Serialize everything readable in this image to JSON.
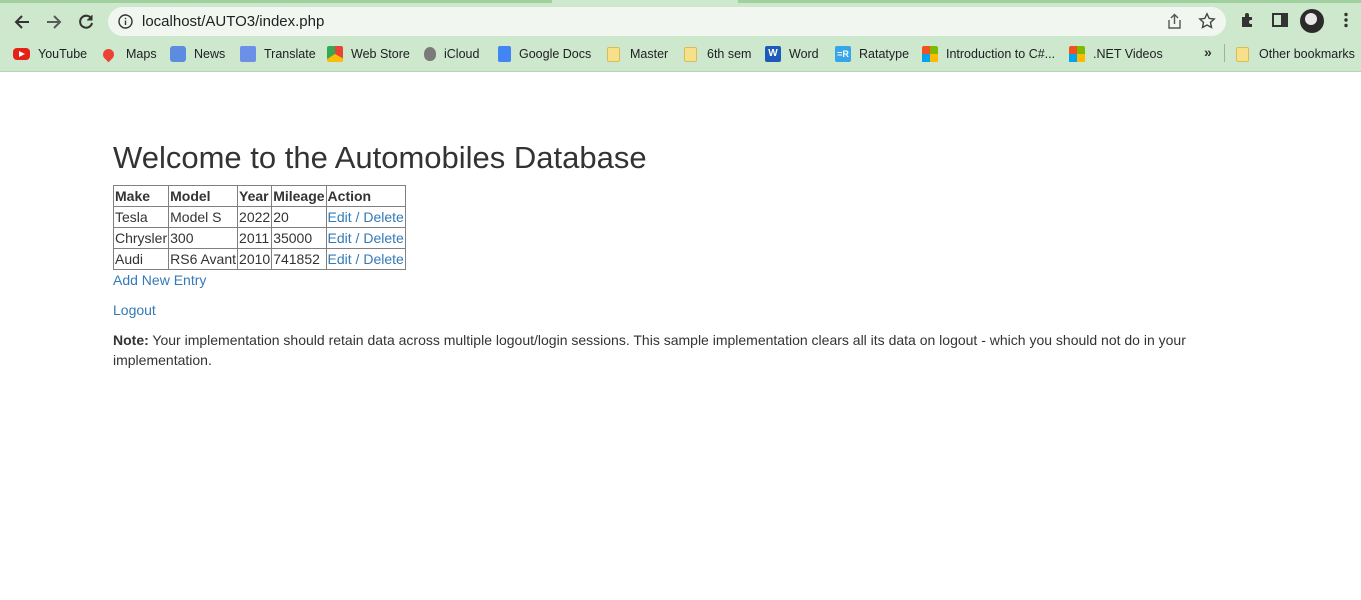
{
  "browser": {
    "url": "localhost/AUTO3/index.php",
    "bookmarks": [
      {
        "label": "YouTube",
        "icon": "youtube-icon"
      },
      {
        "label": "Maps",
        "icon": "maps-icon"
      },
      {
        "label": "News",
        "icon": "news-icon"
      },
      {
        "label": "Translate",
        "icon": "translate-icon"
      },
      {
        "label": "Web Store",
        "icon": "web-store-icon"
      },
      {
        "label": "iCloud",
        "icon": "apple-icon"
      },
      {
        "label": "Google Docs",
        "icon": "docs-icon"
      },
      {
        "label": "Master",
        "icon": "folder-icon"
      },
      {
        "label": "6th sem",
        "icon": "folder-icon"
      },
      {
        "label": "Word",
        "icon": "word-icon"
      },
      {
        "label": "Ratatype",
        "icon": "ratatype-icon"
      },
      {
        "label": "Introduction to C#...",
        "icon": "microsoft-icon"
      },
      {
        "label": ".NET Videos",
        "icon": "microsoft-icon"
      }
    ],
    "other_bookmarks": "Other bookmarks",
    "word_icon_letter": "W",
    "ratatype_icon_letter": "=R",
    "overflow_glyph": "»"
  },
  "page": {
    "title": "Welcome to the Automobiles Database",
    "table": {
      "headers": [
        "Make",
        "Model",
        "Year",
        "Mileage",
        "Action"
      ],
      "rows": [
        {
          "make": "Tesla",
          "model": "Model S",
          "year": "2022",
          "mileage": "20",
          "edit": "Edit",
          "sep": " / ",
          "delete": "Delete"
        },
        {
          "make": "Chrysler",
          "model": "300",
          "year": "2011",
          "mileage": "35000",
          "edit": "Edit",
          "sep": " / ",
          "delete": "Delete"
        },
        {
          "make": "Audi",
          "model": "RS6 Avant",
          "year": "2010",
          "mileage": "741852",
          "edit": "Edit",
          "sep": " / ",
          "delete": "Delete"
        }
      ]
    },
    "add_link": "Add New Entry",
    "logout_link": "Logout",
    "note_label": "Note:",
    "note_text": " Your implementation should retain data across multiple logout/login sessions. This sample implementation clears all its data on logout - which you should not do in your implementation."
  },
  "colors": {
    "link": "#337ab7",
    "text": "#333333",
    "chrome": "#cde8cc"
  }
}
